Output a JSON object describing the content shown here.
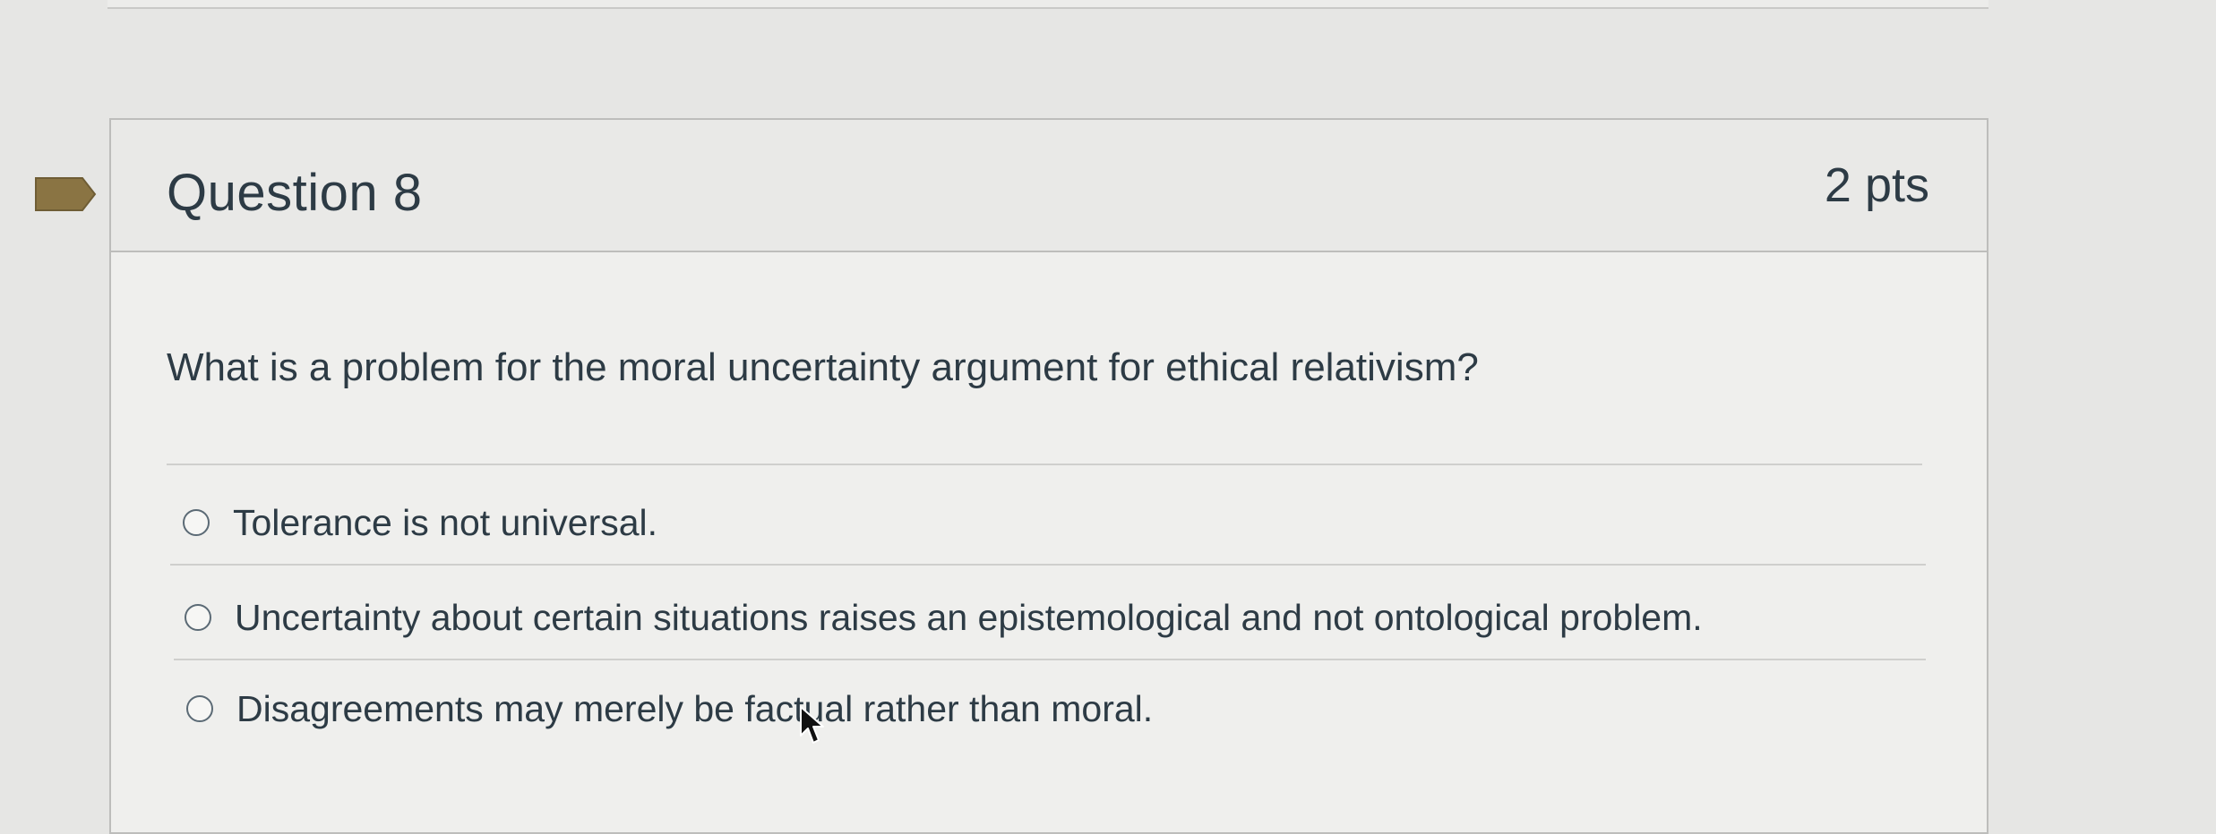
{
  "question": {
    "title": "Question 8",
    "points": "2 pts",
    "text": "What is a problem for the moral uncertainty argument for ethical relativism?",
    "answers": [
      {
        "label": "Tolerance is not universal."
      },
      {
        "label": "Uncertainty about certain situations raises an epistemological and not ontological problem."
      },
      {
        "label": "Disagreements may merely be factual rather than moral."
      }
    ]
  },
  "icons": {
    "flag": "bookmark-flag-icon",
    "radio": "radio-unselected-icon",
    "cursor": "mouse-pointer-icon"
  },
  "colors": {
    "text": "#2d3b45",
    "flag": "#8a7443",
    "background": "#e6e6e4"
  }
}
